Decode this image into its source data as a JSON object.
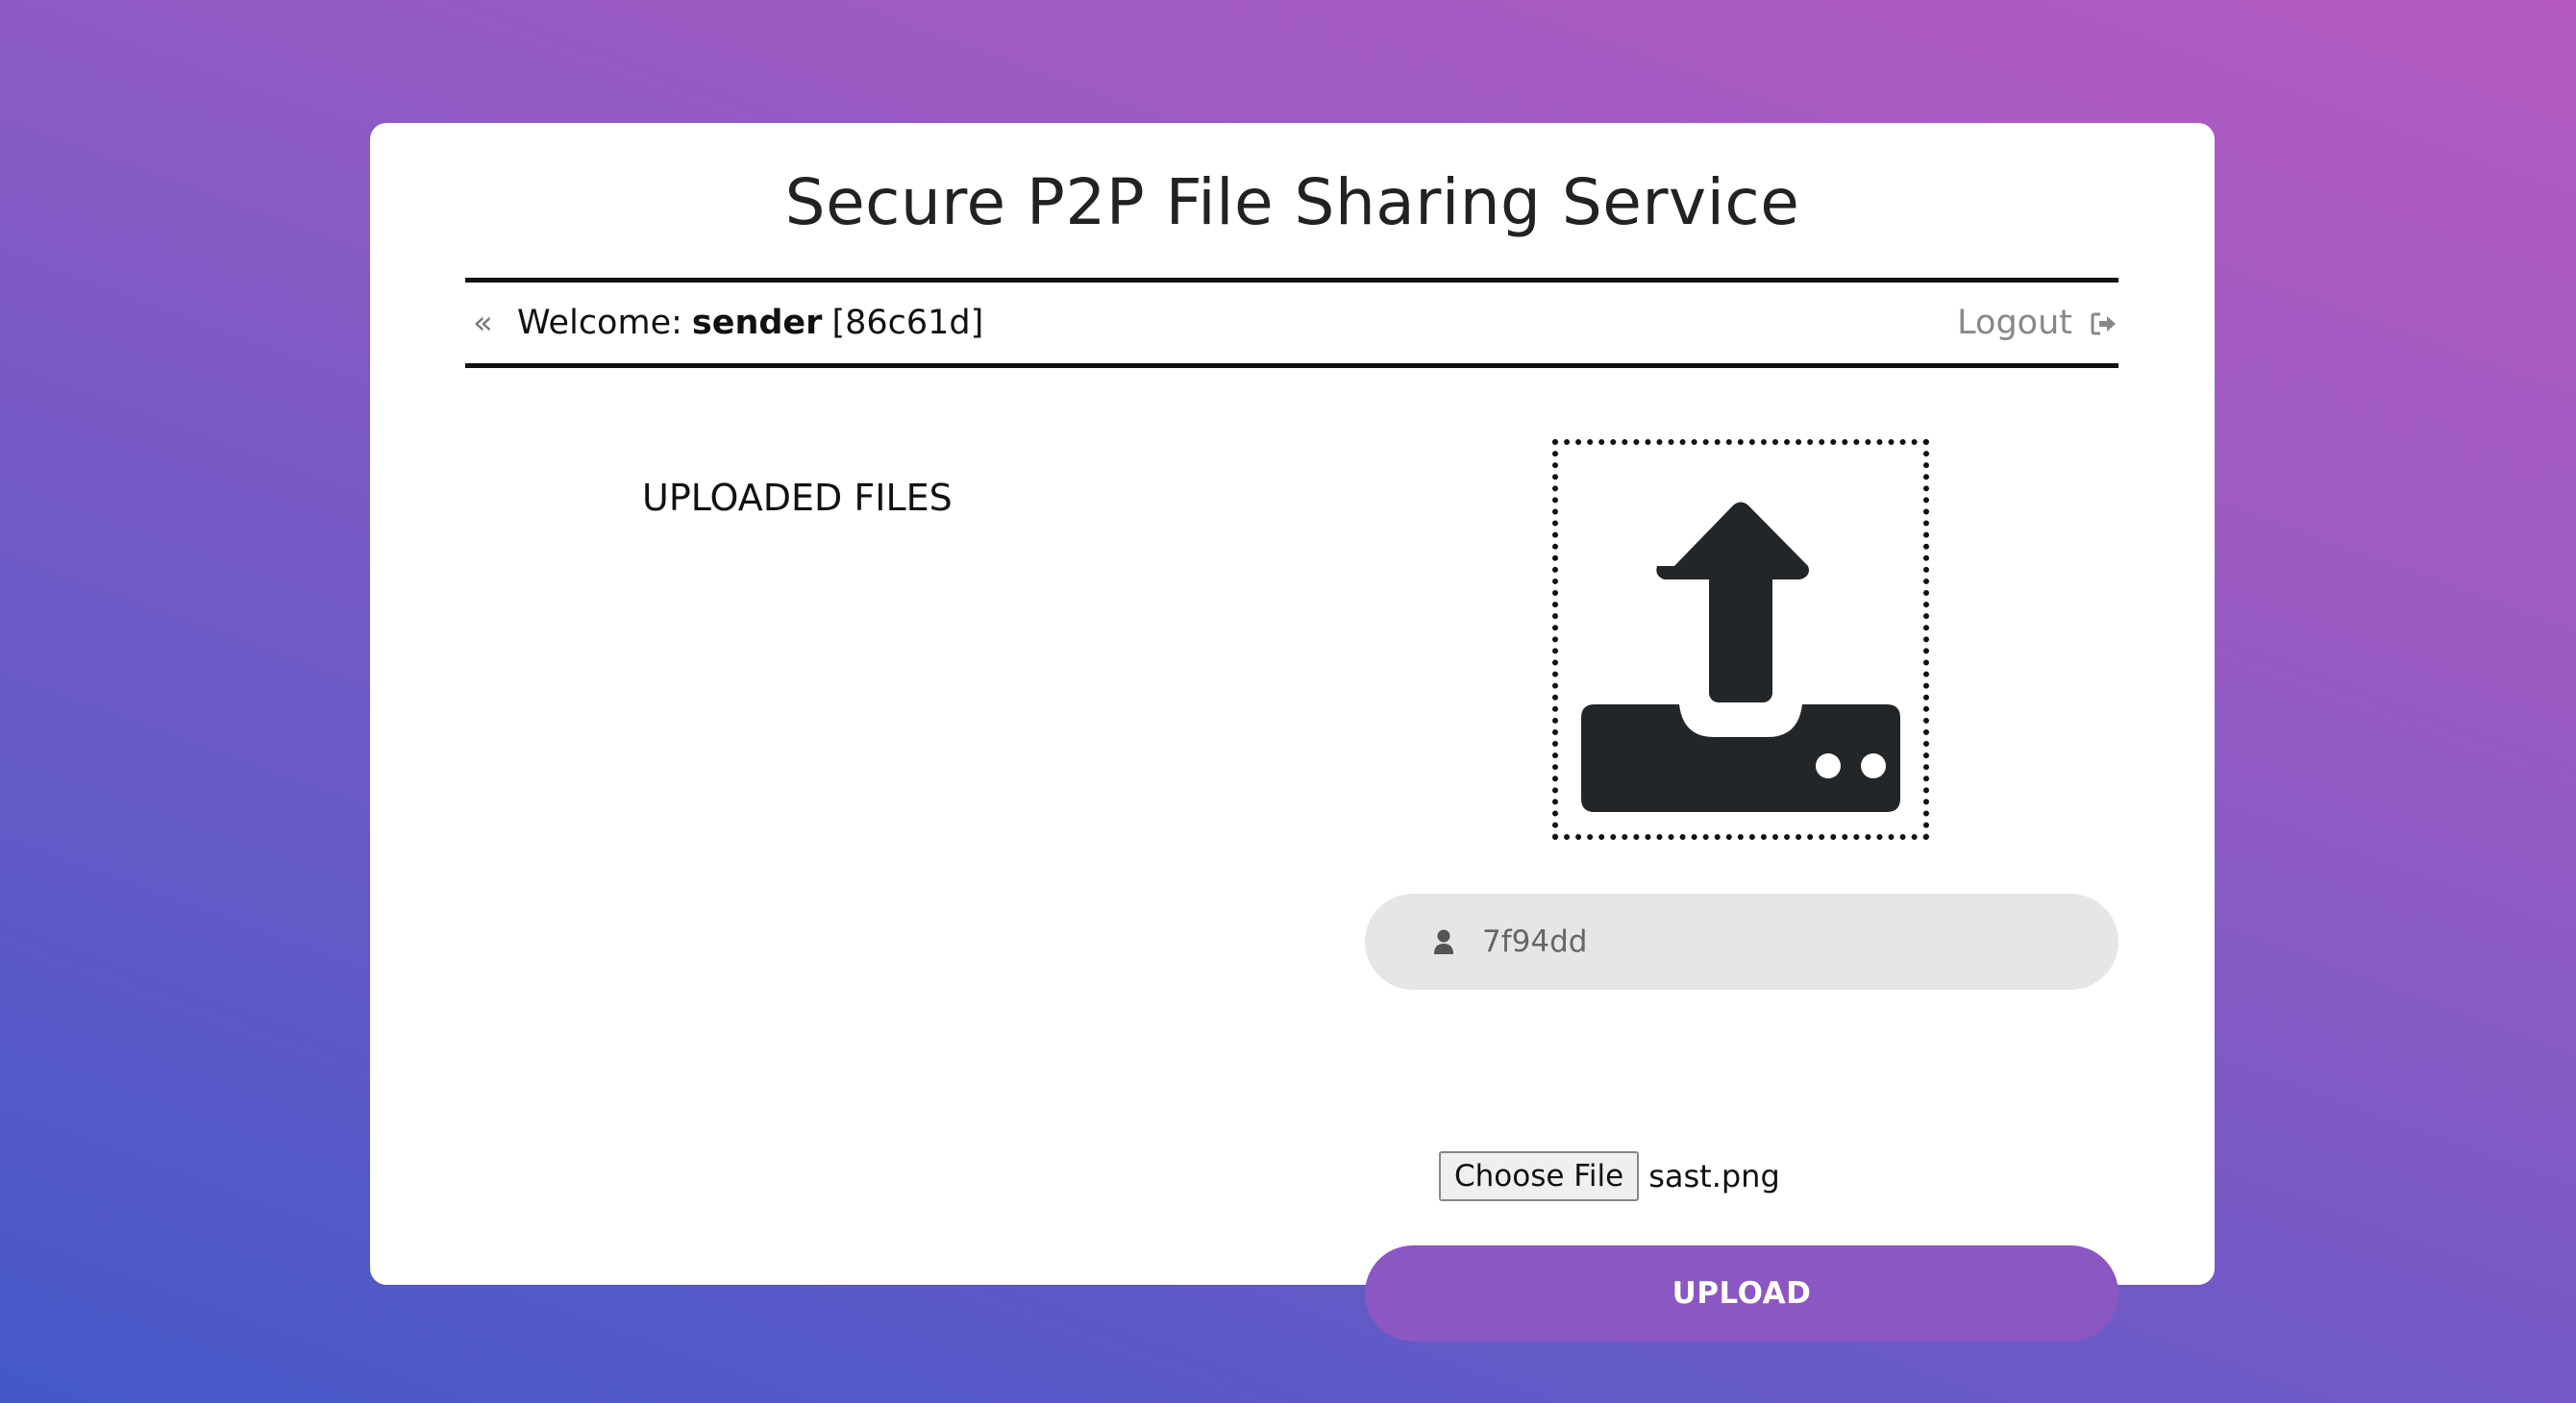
{
  "app": {
    "title": "Secure P2P File Sharing Service"
  },
  "header": {
    "welcome_prefix": "Welcome:",
    "username": "sender",
    "user_id": "[86c61d]",
    "logout_label": "Logout",
    "back_icon": "double-chevron-left-icon",
    "logout_icon": "sign-out-icon"
  },
  "files_panel": {
    "heading": "UPLOADED FILES",
    "files": []
  },
  "upload_panel": {
    "dropzone_icon": "upload-tray-icon",
    "recipient_icon": "user-icon",
    "recipient_value": "7f94dd",
    "choose_file_label": "Choose File",
    "selected_file": "sast.png",
    "upload_label": "UPLOAD"
  },
  "colors": {
    "accent": "#8b57c2",
    "gradient_start": "#4558c9",
    "gradient_end": "#b45ac0",
    "input_bg": "#e6e6e6"
  }
}
